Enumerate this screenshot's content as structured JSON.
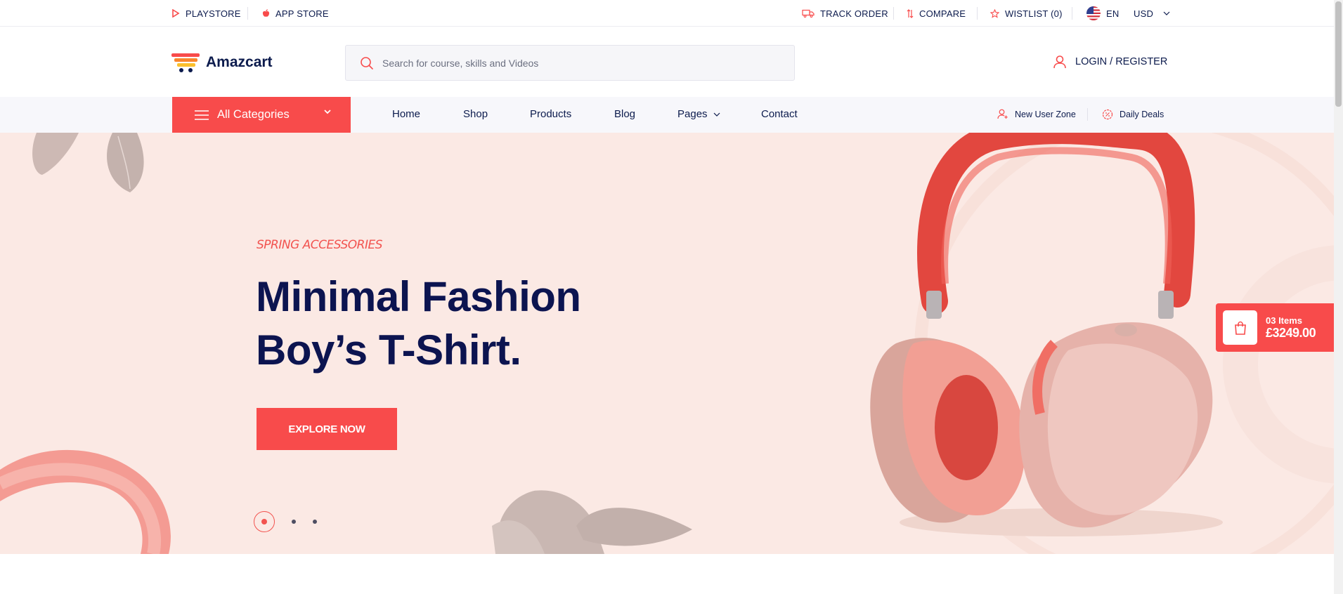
{
  "topbar": {
    "playstore": "PLAYSTORE",
    "appstore": "APP STORE",
    "track_order": "TRACK ORDER",
    "compare": "COMPARE",
    "wishlist": "WISTLIST (0)",
    "language": "EN",
    "currency": "USD"
  },
  "header": {
    "logo": "Amazcart",
    "search_placeholder": "Search for course, skills and Videos",
    "login": "LOGIN / REGISTER"
  },
  "nav": {
    "all_categories": "All Categories",
    "links": [
      "Home",
      "Shop",
      "Products",
      "Blog",
      "Pages",
      "Contact"
    ],
    "new_user_zone": "New User Zone",
    "daily_deals": "Daily Deals"
  },
  "hero": {
    "subtitle": "SPRING ACCESSORIES",
    "title_line1": "Minimal Fashion",
    "title_line2": "Boy’s T-Shirt.",
    "button": "EXPLORE NOW",
    "slide_count": 3,
    "active_slide": 1
  },
  "cart": {
    "count": "03 Items",
    "total": "£3249.00"
  },
  "colors": {
    "accent": "#f84b4b",
    "navy": "#0c1450",
    "hero_bg": "#fbe9e4",
    "nav_bg": "#f7f7fb"
  },
  "icons": [
    "play-icon",
    "apple-icon",
    "truck-icon",
    "compare-icon",
    "star-icon",
    "us-flag-icon",
    "chevron-down-icon",
    "cart-logo-icon",
    "search-icon",
    "user-icon",
    "menu-icon",
    "user-plus-icon",
    "deals-icon",
    "bag-icon"
  ]
}
